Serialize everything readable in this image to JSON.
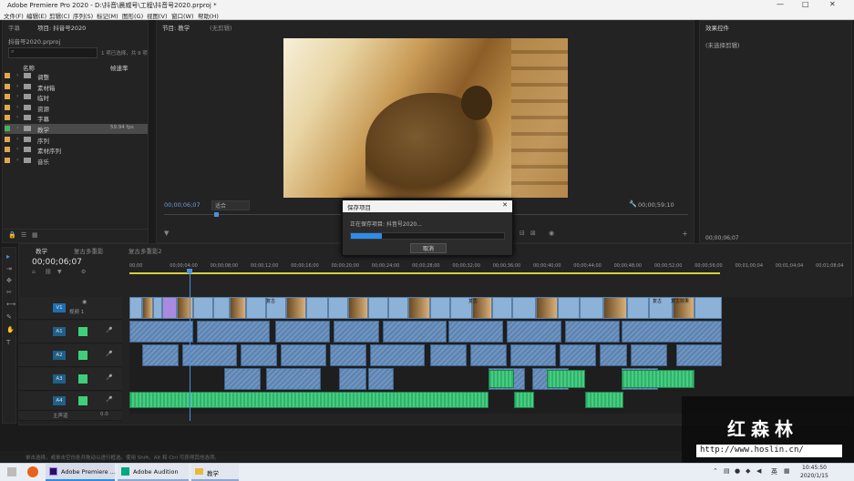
{
  "window": {
    "title": "Adobe Premiere Pro 2020 - D:\\抖音\\晨威号\\工程\\抖音号2020.prproj *",
    "controls": [
      "—",
      "□",
      "✕"
    ]
  },
  "menu": [
    "文件(F)",
    "编辑(E)",
    "剪辑(C)",
    "序列(S)",
    "标记(M)",
    "图形(G)",
    "视图(V)",
    "窗口(W)",
    "帮助(H)"
  ],
  "project": {
    "tabs": [
      "字幕",
      "项目: 抖音号2020"
    ],
    "file_name": "抖音号2020.prproj",
    "selection": "1 项已选择，共 9 项",
    "col_name": "名称",
    "col_rate": "帧速率",
    "folders": [
      {
        "name": "调整",
        "color": "#e0a84a",
        "rate": "",
        "selected": false
      },
      {
        "name": "素材箱",
        "color": "#e0a84a",
        "rate": "",
        "selected": false
      },
      {
        "name": "临时",
        "color": "#e0a84a",
        "rate": "",
        "selected": false
      },
      {
        "name": "资源",
        "color": "#e0a84a",
        "rate": "",
        "selected": false
      },
      {
        "name": "字幕",
        "color": "#e0a84a",
        "rate": "",
        "selected": false
      },
      {
        "name": "教学",
        "color": "#48b35c",
        "rate": "59.94 fps",
        "selected": true
      },
      {
        "name": "序列",
        "color": "#e0a84a",
        "rate": "",
        "selected": false
      },
      {
        "name": "素材序列",
        "color": "#e0a84a",
        "rate": "",
        "selected": false
      },
      {
        "name": "音乐",
        "color": "#e0a84a",
        "rate": "",
        "selected": false
      }
    ]
  },
  "program": {
    "tabs": [
      "节目: 教学",
      "(无剪辑)"
    ],
    "timecode_left": "00;00;06;07",
    "fit": "适合",
    "timecode_right": "00;00;59;10"
  },
  "effects": {
    "tab": "效果控件",
    "no_clip": "(未选择剪辑)",
    "timecode": "00;00;06;07"
  },
  "dialog": {
    "title": "保存项目",
    "message": "正在保存项目: 抖音号2020...",
    "progress": 0.2,
    "cancel": "取消"
  },
  "timeline": {
    "tabs": [
      "教学",
      "复古多重影",
      "复古多重影2"
    ],
    "timecode": "00;00;06;07",
    "ruler": [
      "00;00",
      "00;00;04;00",
      "00;00;08;00",
      "00;00;12;00",
      "00;00;16;00",
      "00;00;20;00",
      "00;00;24;00",
      "00;00;28;00",
      "00;00;32;00",
      "00;00;36;00",
      "00;00;40;00",
      "00;00;44;00",
      "00;00;48;00",
      "00;00;52;00",
      "00;00;56;00",
      "00;01;00;04",
      "00;01;04;04",
      "00;01;08;04"
    ],
    "tracks": [
      {
        "id": "V1",
        "label": "视频 1"
      },
      {
        "id": "A1",
        "label": ""
      },
      {
        "id": "A2",
        "label": ""
      },
      {
        "id": "A3",
        "label": ""
      },
      {
        "id": "A4",
        "label": ""
      },
      {
        "id": "M",
        "label": "主声道"
      }
    ],
    "master_value": "0.0",
    "clip_labels": [
      "复古",
      "复古",
      "复古",
      "复古效果"
    ]
  },
  "status": "单击选择，或单击空白处并拖动以进行框选。使用 Shift、Alt 和 Ctrl 可获得其他选项。",
  "watermark": {
    "name": "红森林",
    "url": "http://www.hoslin.cn/"
  },
  "taskbar": {
    "apps": [
      {
        "label": "Adobe Premiere ..."
      },
      {
        "label": "Adobe Audition"
      },
      {
        "label": "教学"
      }
    ],
    "ime": "英",
    "time": "10:45:50",
    "date": "2020/1/15"
  },
  "colors": {
    "accent": "#2d8ceb",
    "premiere": "#2a0f5f",
    "audition": "#00a77f",
    "green_clip": "#2fb36b"
  }
}
